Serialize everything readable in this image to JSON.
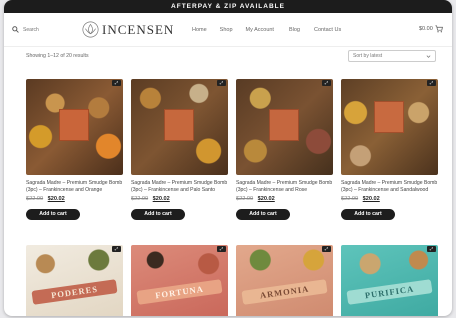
{
  "announcement": "AFTERPAY & ZIP AVAILABLE",
  "search": {
    "placeholder": "Search"
  },
  "logo": {
    "text": "INCENSEN"
  },
  "nav": [
    "Home",
    "Shop",
    "My Account",
    "Blog",
    "Contact Us"
  ],
  "cart": {
    "total": "$0.00",
    "count": "0"
  },
  "toolbar": {
    "results": "Showing 1–12 of 20 results",
    "sort": "Sort by latest"
  },
  "products": [
    {
      "title": "Sagrada Madre – Premium Smudge Bomb (3pc) – Frankincense and Orange",
      "old_price": "$22.00",
      "new_price": "$20.02",
      "button": "Add to cart"
    },
    {
      "title": "Sagrada Madre – Premium Smudge Bomb (3pc) – Frankincense and Palo Santo",
      "old_price": "$22.00",
      "new_price": "$20.02",
      "button": "Add to cart"
    },
    {
      "title": "Sagrada Madre – Premium Smudge Bomb (3pc) – Frankincense and Rose",
      "old_price": "$22.00",
      "new_price": "$20.02",
      "button": "Add to cart"
    },
    {
      "title": "Sagrada Madre – Premium Smudge Bomb (3pc) – Frankincense and Sandalwood",
      "old_price": "$22.00",
      "new_price": "$20.02",
      "button": "Add to cart"
    }
  ],
  "row2": [
    {
      "label": "PODERES",
      "bg": "#efe6d6"
    },
    {
      "label": "FORTUNA",
      "bg": "#d8786a"
    },
    {
      "label": "ARMONIA",
      "bg": "#d9917a"
    },
    {
      "label": "PURIFICA",
      "bg": "#4fbdb5"
    }
  ],
  "colors": {
    "header_bar": "#1c1c1c",
    "button": "#1d1d1d",
    "product_bg": "#6b4a2e"
  }
}
